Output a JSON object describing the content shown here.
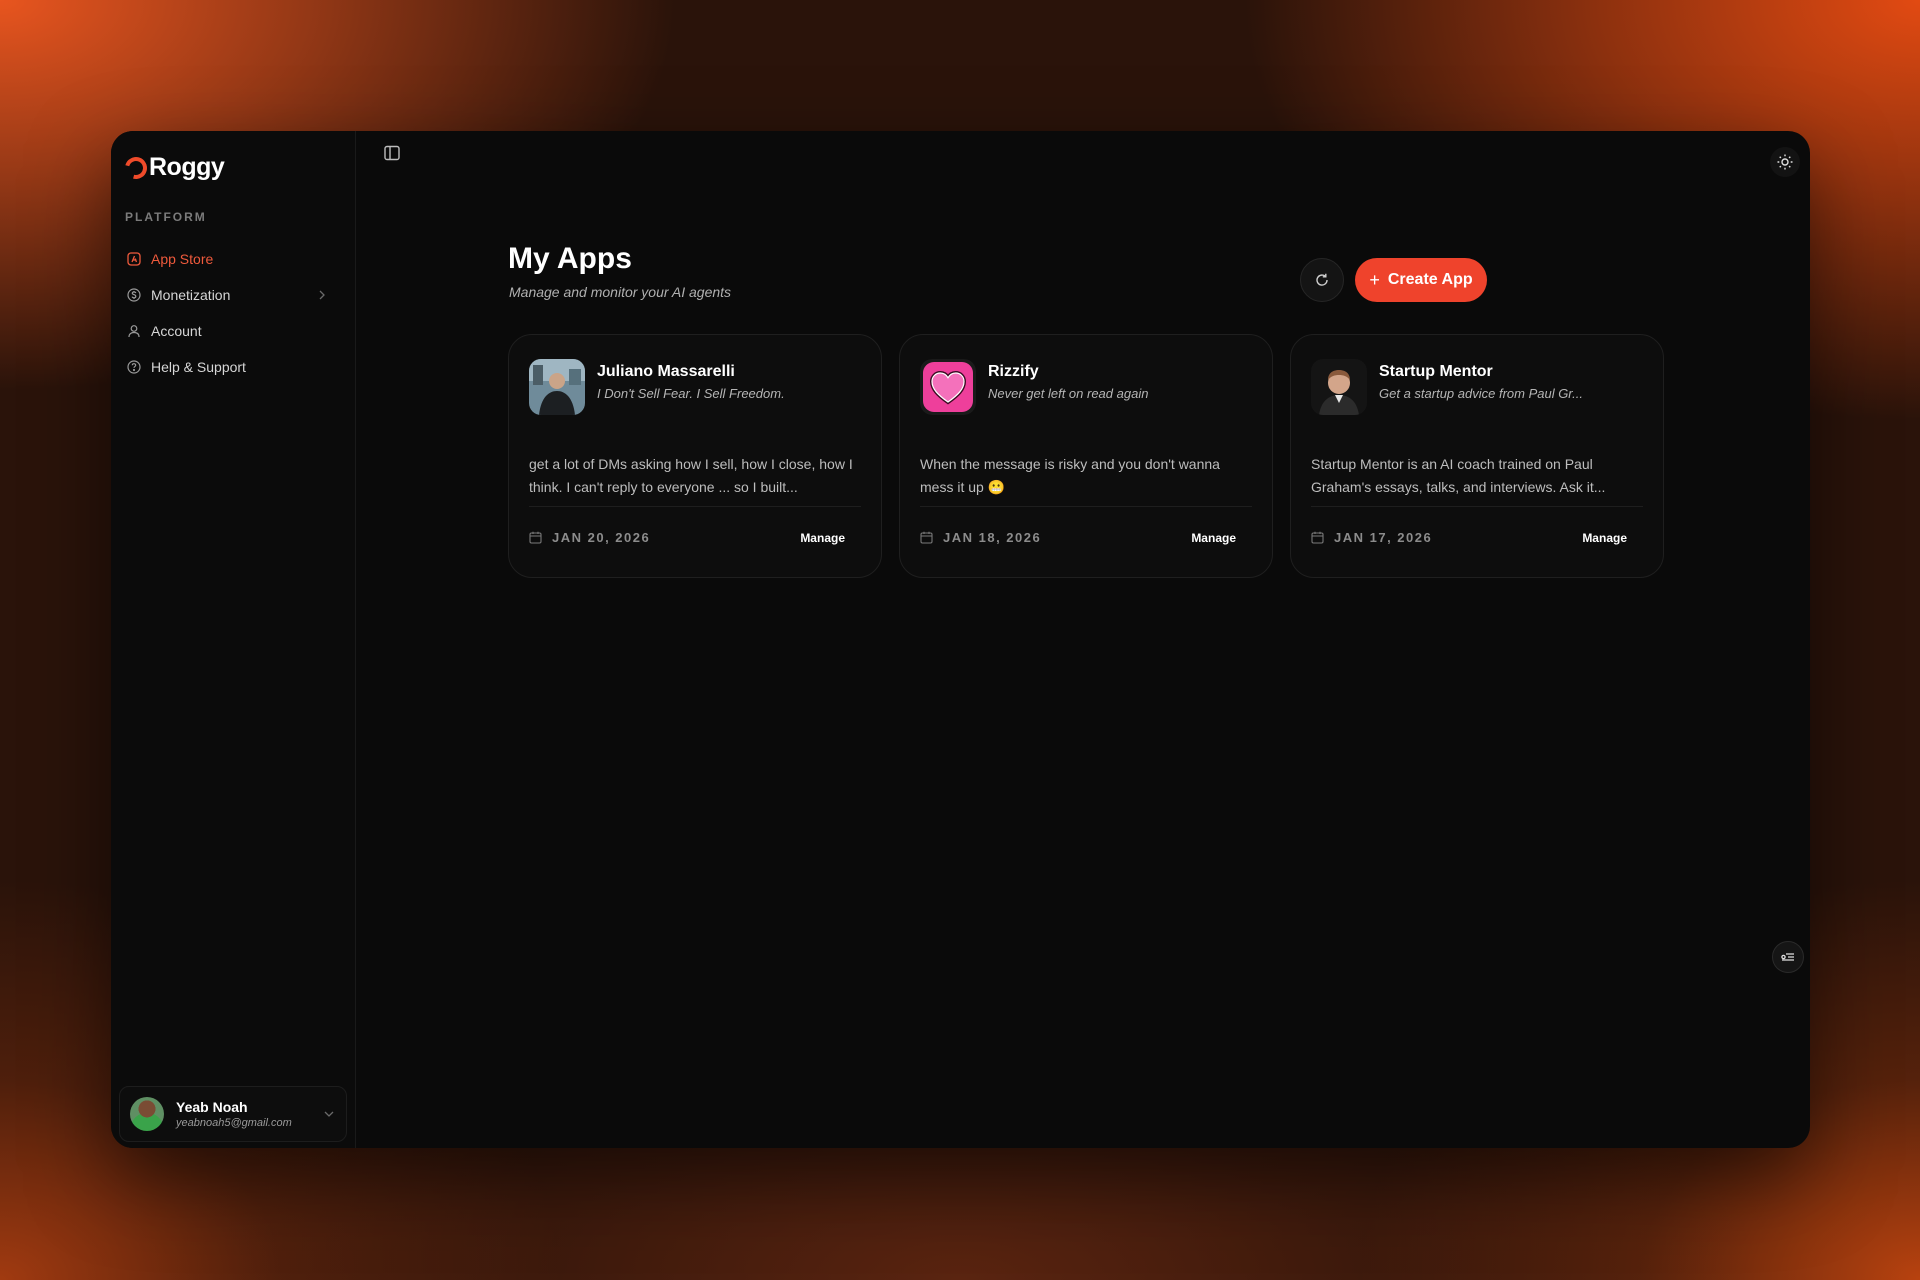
{
  "brand": {
    "name": "Roggy",
    "accent": "#ef4b2a"
  },
  "sidebar": {
    "section_label": "PLATFORM",
    "items": [
      {
        "label": "App Store",
        "icon": "app-store-icon",
        "active": true
      },
      {
        "label": "Monetization",
        "icon": "dollar-circle-icon",
        "has_submenu": true
      },
      {
        "label": "Account",
        "icon": "user-icon"
      },
      {
        "label": "Help & Support",
        "icon": "help-circle-icon"
      }
    ]
  },
  "user": {
    "name": "Yeab Noah",
    "email": "yeabnoah5@gmail.com"
  },
  "main": {
    "title": "My Apps",
    "subtitle": "Manage and monitor your AI agents",
    "create_label": "Create App"
  },
  "apps": [
    {
      "name": "Juliano Massarelli",
      "tagline": "I Don't Sell Fear. I Sell Freedom.",
      "description": "get a lot of DMs asking how I sell, how I close, how I think. I can't reply to everyone ... so I built...",
      "date": "JAN 20, 2026",
      "manage_label": "Manage"
    },
    {
      "name": "Rizzify",
      "tagline": "Never get left on read again",
      "description": "When the message is risky and you don't wanna mess it up 😬",
      "date": "JAN 18, 2026",
      "manage_label": "Manage"
    },
    {
      "name": "Startup Mentor",
      "tagline": "Get a startup advice from Paul Gr...",
      "description": "Startup Mentor is an AI coach trained on Paul Graham's essays, talks, and interviews. Ask it...",
      "date": "JAN 17, 2026",
      "manage_label": "Manage"
    }
  ],
  "colors": {
    "primary_button": "#ef432c",
    "window_bg": "#0a0a0a",
    "active_nav": "#ef5a3c"
  }
}
